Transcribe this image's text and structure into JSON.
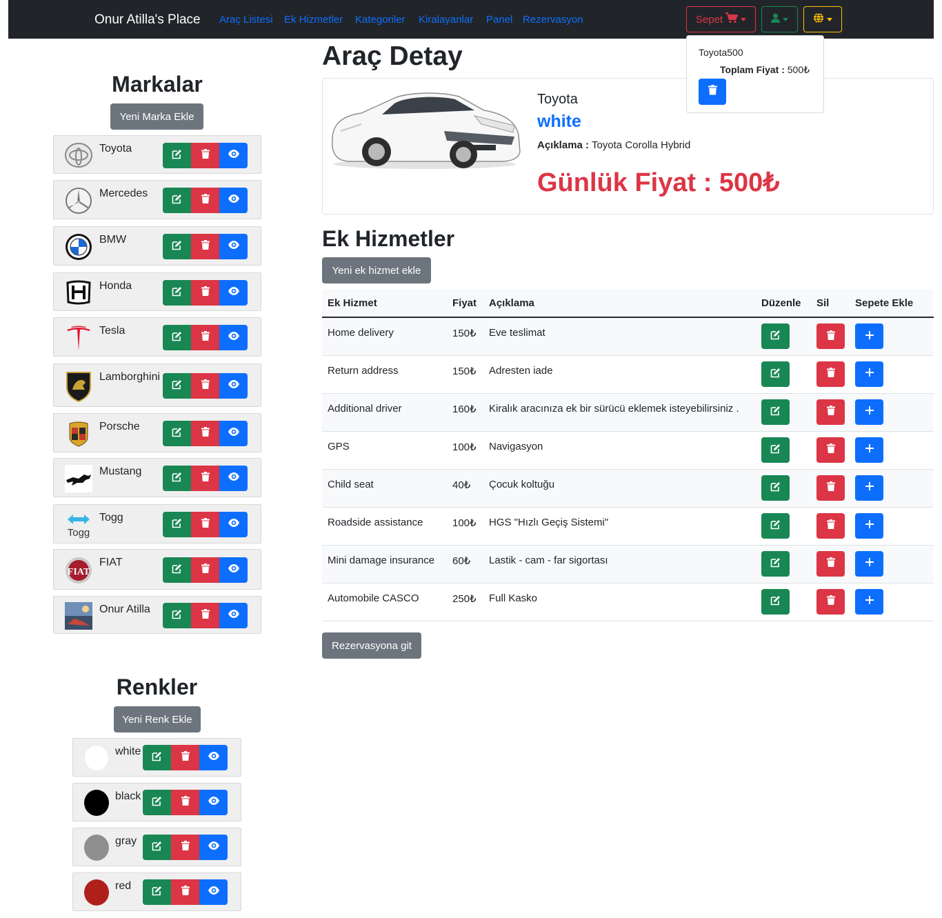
{
  "navbar": {
    "brand": "Onur Atilla's Place",
    "links": [
      "Araç Listesi",
      "Ek Hizmetler",
      "Kategoriler",
      "Kiralayanlar",
      "Panel",
      "Rezervasyon"
    ],
    "cart_label": "Sepet",
    "cart_color": "#dc3545",
    "user_color": "#198754",
    "lang_color": "#ffc107"
  },
  "cart": {
    "item": "Toyota500",
    "total_label": "Toplam Fiyat :",
    "total_value": "500₺"
  },
  "brands_section": {
    "title": "Markalar",
    "add_button": "Yeni Marka Ekle",
    "items": [
      {
        "name": "Toyota",
        "logo": "toyota-logo"
      },
      {
        "name": "Mercedes",
        "logo": "mercedes-logo"
      },
      {
        "name": "BMW",
        "logo": "bmw-logo"
      },
      {
        "name": "Honda",
        "logo": "honda-logo"
      },
      {
        "name": "Tesla",
        "logo": "tesla-logo"
      },
      {
        "name": "Lamborghini",
        "logo": "lamborghini-logo"
      },
      {
        "name": "Porsche",
        "logo": "porsche-logo"
      },
      {
        "name": "Mustang",
        "logo": "mustang-logo"
      },
      {
        "name": "Togg",
        "logo": "togg-logo",
        "logo_text": "Togg"
      },
      {
        "name": "FIAT",
        "logo": "fiat-logo",
        "logo_text": "FIAT"
      },
      {
        "name": "Onur Atilla",
        "logo": "onur-atilla-photo"
      }
    ]
  },
  "colors_section": {
    "title": "Renkler",
    "add_button": "Yeni Renk Ekle",
    "items": [
      {
        "name": "white",
        "swatch": "#ffffff"
      },
      {
        "name": "black",
        "swatch": "#000000"
      },
      {
        "name": "gray",
        "swatch": "#8f8f8f"
      },
      {
        "name": "red",
        "swatch": "#b0201b"
      }
    ]
  },
  "car_detail": {
    "heading": "Araç Detay",
    "brand": "Toyota",
    "color": "white",
    "desc_label": "Açıklama :",
    "desc_value": "Toyota Corolla Hybrid",
    "price": "Günlük Fiyat : 500₺"
  },
  "services": {
    "heading": "Ek Hizmetler",
    "add_button": "Yeni ek hizmet ekle",
    "columns": [
      "Ek Hizmet",
      "Fiyat",
      "Açıklama",
      "Düzenle",
      "Sil",
      "Sepete Ekle"
    ],
    "rows": [
      {
        "name": "Home delivery",
        "price": "150₺",
        "desc": "Eve teslimat"
      },
      {
        "name": "Return address",
        "price": "150₺",
        "desc": "Adresten iade"
      },
      {
        "name": "Additional driver",
        "price": "160₺",
        "desc": "Kiralık aracınıza ek bir sürücü eklemek isteyebilirsiniz ."
      },
      {
        "name": "GPS",
        "price": "100₺",
        "desc": "Navigasyon"
      },
      {
        "name": "Child seat",
        "price": "40₺",
        "desc": "Çocuk koltuğu"
      },
      {
        "name": "Roadside assistance",
        "price": "100₺",
        "desc": "HGS \"Hızlı Geçiş Sistemi\""
      },
      {
        "name": "Mini damage insurance",
        "price": "60₺",
        "desc": "Lastik - cam - far sigortası"
      },
      {
        "name": "Automobile CASCO",
        "price": "250₺",
        "desc": "Full Kasko"
      }
    ],
    "go_button": "Rezervasyona git"
  }
}
